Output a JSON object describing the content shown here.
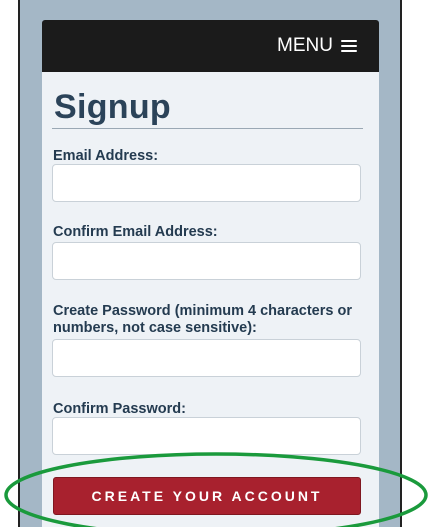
{
  "nav": {
    "menu_label": "MENU"
  },
  "form": {
    "title": "Signup",
    "fields": [
      {
        "label": "Email Address:",
        "value": "",
        "placeholder": ""
      },
      {
        "label": "Confirm Email Address:",
        "value": "",
        "placeholder": ""
      },
      {
        "label": "Create Password (minimum 4 characters or numbers, not case sensitive):",
        "value": "",
        "placeholder": ""
      },
      {
        "label": "Confirm Password:",
        "value": "",
        "placeholder": ""
      }
    ],
    "submit_label": "CREATE YOUR ACCOUNT"
  },
  "colors": {
    "nav_bg": "#1b1b1b",
    "title": "#2b4359",
    "button": "#a8212e",
    "highlight_ellipse": "#1a9a3c"
  },
  "icons": {
    "menu": "hamburger-icon"
  }
}
